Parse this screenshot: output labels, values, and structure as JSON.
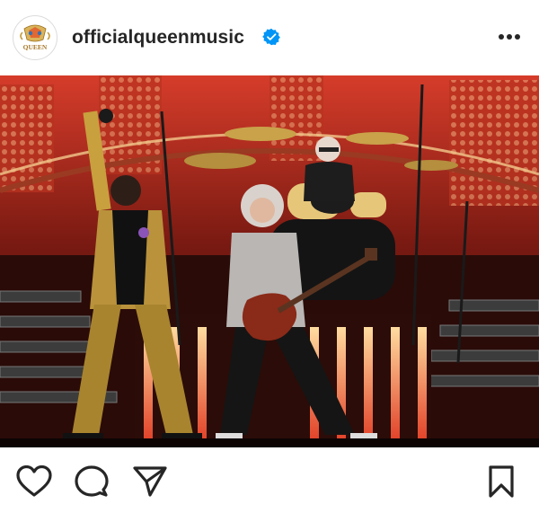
{
  "post": {
    "account": {
      "username": "officialqueenmusic",
      "verified": true,
      "avatar": "queen-crest-logo",
      "avatar_text": "QUEEN"
    },
    "header_actions": {
      "more_icon": "more-options-icon"
    },
    "media": {
      "type": "photo",
      "description_icon": "concert-photo"
    },
    "actions": {
      "like_icon": "heart-icon",
      "comment_icon": "comment-icon",
      "share_icon": "send-icon",
      "save_icon": "bookmark-icon"
    }
  },
  "colors": {
    "text": "#262626",
    "verified": "#0095f6",
    "stage_red": "#c0291f",
    "logo_gold": "#c49a3a"
  }
}
